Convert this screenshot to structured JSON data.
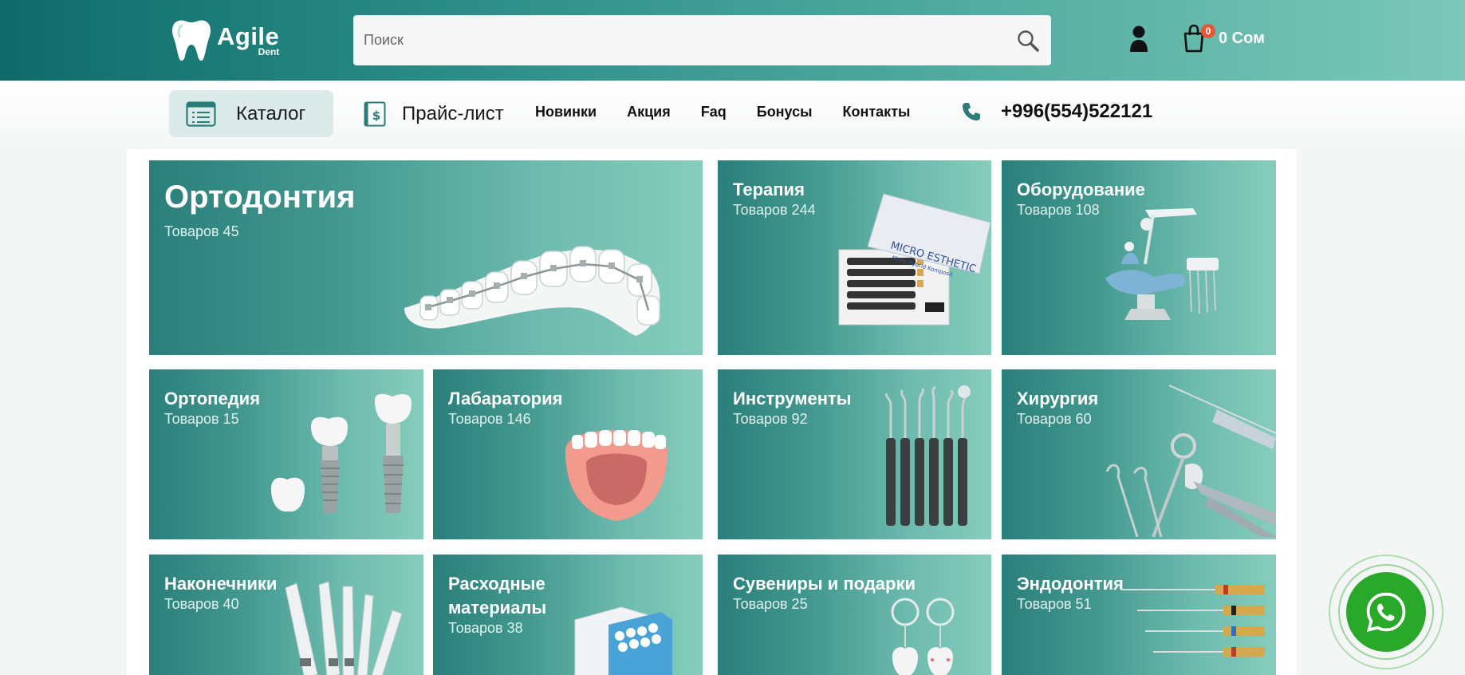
{
  "header": {
    "logo_main": "Agile",
    "logo_sub": "Dent",
    "search_placeholder": "Поиск",
    "cart_count": "0",
    "cart_total": "0 Сом"
  },
  "nav": {
    "catalog_label": "Каталог",
    "price_list_label": "Прайс-лист",
    "links": [
      "Новинки",
      "Акция",
      "Faq",
      "Бонусы",
      "Контакты"
    ],
    "phone": "+996(554)522121"
  },
  "categories": [
    {
      "title": "Ортодонтия",
      "count": "Товаров 45"
    },
    {
      "title": "Терапия",
      "count": "Товаров 244"
    },
    {
      "title": "Оборудование",
      "count": "Товаров 108"
    },
    {
      "title": "Ортопедия",
      "count": "Товаров 15"
    },
    {
      "title": "Лабаратория",
      "count": "Товаров 146"
    },
    {
      "title": "Инструменты",
      "count": "Товаров 92"
    },
    {
      "title": "Хирургия",
      "count": "Товаров 60"
    },
    {
      "title": "Наконечники",
      "count": "Товаров 40"
    },
    {
      "title": "Расходные материалы",
      "count": "Товаров 38"
    },
    {
      "title": "Сувениры и подарки",
      "count": "Товаров 25"
    },
    {
      "title": "Эндодонтия",
      "count": "Товаров 51"
    }
  ],
  "colors": {
    "accent": "#1f7d78",
    "whatsapp": "#2aa82a",
    "badge": "#e8563a"
  },
  "icons": [
    "tooth-logo-icon",
    "search-icon",
    "user-icon",
    "cart-icon",
    "catalog-list-icon",
    "price-list-icon",
    "phone-icon",
    "whatsapp-icon"
  ]
}
